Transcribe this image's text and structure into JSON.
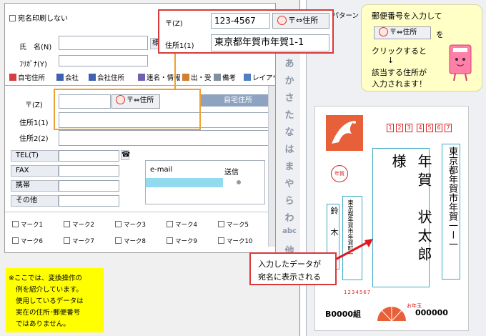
{
  "form": {
    "print_exclude_label": "宛名印刷しない",
    "name_label": "氏　名(N)",
    "name_suffix": "様",
    "furigana_label": "ﾌﾘｶﾞﾅ(Y)",
    "tabs": [
      "自宅住所",
      "会社",
      "会社住所",
      "連名・情報",
      "出・受",
      "備考",
      "レイアウ"
    ],
    "zip_label": "〒(Z)",
    "addr1_label": "住所1(1)",
    "addr2_label": "住所2(2)",
    "address_type_label": "自宅住所",
    "conv_button_label": "〒⇔住所",
    "phone_buttons": [
      "TEL(T)",
      "FAX",
      "携帯",
      "その他"
    ],
    "email_header": "e-mail",
    "send_header": "送信",
    "marks": [
      "マーク1",
      "マーク2",
      "マーク3",
      "マーク4",
      "マーク5",
      "マーク6",
      "マーク7",
      "マーク8",
      "マーク9",
      "マーク10"
    ]
  },
  "kana_index": [
    "あ",
    "か",
    "さ",
    "た",
    "な",
    "は",
    "ま",
    "や",
    "ら",
    "わ",
    "abc",
    "他"
  ],
  "zip_callout": {
    "zip_label": "〒(Z)",
    "zip_value": "123-4567",
    "conv_button_label": "〒⇔住所",
    "addr_label": "住所1(1)",
    "addr_value": "東京都年賀市年賀1-1"
  },
  "partial_header": "の パターン",
  "tip_bubble": {
    "line1": "郵便番号を入力して",
    "button_label": "〒⇔住所",
    "after_button": "を",
    "line2": "クリックすると",
    "arrow": "↓",
    "line3": "該当する住所が",
    "line4": "入力されます！"
  },
  "postcard": {
    "zip_digits": [
      "1",
      "2",
      "3",
      "4",
      "5",
      "6",
      "7"
    ],
    "recipient_address": "東京都年賀市年賀一ー一",
    "recipient_name": "年賀　状太郎　様",
    "sender_name": "鈴　木",
    "sender_tail": "郎",
    "sender_address": "東京都年賀市年賀町一",
    "stamp_text": "年賀",
    "sender_zip": "1234567",
    "lottery_left": "B0000組",
    "lottery_right": "000000",
    "postage_label": "お年玉"
  },
  "data_callout": {
    "line1": "入力したデータが",
    "line2": "宛名に表示される"
  },
  "note_box": {
    "lines": [
      "※ここでは、変換操作の",
      "例を紹介しています。",
      "使用しているデータは",
      "実在の住所･郵便番号",
      "ではありません。"
    ]
  },
  "colors": {
    "callout_border": "#d8393b",
    "highlight_frame": "#f0a030",
    "note_background": "#ffff00",
    "bubble_background": "#ffffc6"
  }
}
